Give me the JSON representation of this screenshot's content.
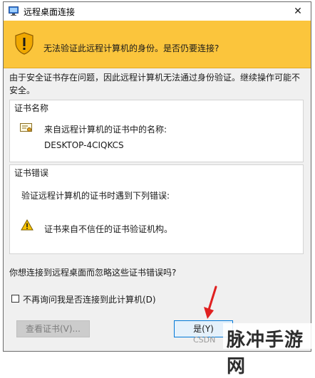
{
  "window": {
    "title": "远程桌面连接",
    "close_glyph": "✕"
  },
  "banner": {
    "text": "无法验证此远程计算机的身份。是否仍要连接?"
  },
  "description": "由于安全证书存在问题，因此远程计算机无法通过身份验证。继续操作可能不安全。",
  "cert_name_group": {
    "title": "证书名称",
    "line1": "来自远程计算机的证书中的名称:",
    "line2": "DESKTOP-4CIQKCS"
  },
  "cert_error_group": {
    "title": "证书错误",
    "line1": "验证远程计算机的证书时遇到下列错误:",
    "line2": "证书来自不信任的证书验证机构。"
  },
  "question": "你想连接到远程桌面而忽略这些证书错误吗?",
  "checkbox": {
    "label": "不再询问我是否连接到此计算机(D)",
    "checked": false
  },
  "buttons": {
    "view_cert": "查看证书(V)...",
    "yes": "是(Y)"
  },
  "watermark": {
    "small": "CSDN",
    "large": "脉冲手游网"
  },
  "colors": {
    "banner": "#fbc53c",
    "arrow": "#e02020",
    "focus_border": "#0078d7"
  },
  "icons": {
    "app": "remote-desktop-icon",
    "banner": "warning-shield-icon",
    "certificate": "certificate-icon",
    "warning": "warning-triangle-icon"
  }
}
